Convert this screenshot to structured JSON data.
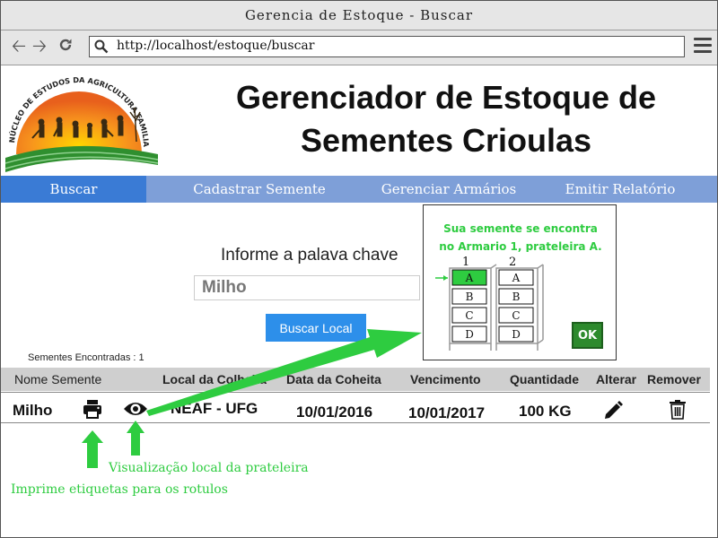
{
  "window": {
    "title": "Gerencia de Estoque - Buscar"
  },
  "browser": {
    "url": "http://localhost/estoque/buscar"
  },
  "logo": {
    "text": "NÚCLEO DE ESTUDOS DA AGRICULTURA FAMILIAR"
  },
  "header": {
    "title_line1": "Gerenciador de Estoque de",
    "title_line2": "Sementes Crioulas"
  },
  "nav": {
    "items": [
      "Buscar",
      "Cadastrar Semente",
      "Gerenciar Armários",
      "Emitir Relatório"
    ]
  },
  "search": {
    "label": "Informe a palava chave",
    "value": "Milho",
    "placeholder": "Milho",
    "button": "Buscar Local"
  },
  "results": {
    "found_label": "Sementes Encontradas : 1",
    "columns": [
      "Nome Semente",
      "Local da Colheita",
      "Data da Coheita",
      "Vencimento",
      "Quantidade",
      "Alterar",
      "Remover"
    ],
    "row": {
      "name": "Milho",
      "local": "NEAF - UFG",
      "data_colheita": "10/01/2016",
      "vencimento": "10/01/2017",
      "quantidade": "100 KG"
    }
  },
  "popup": {
    "message_line1": "Sua semente se encontra",
    "message_line2": "no Armario 1, prateleira A.",
    "cabinets": [
      {
        "label": "1",
        "shelves": [
          "A",
          "B",
          "C",
          "D"
        ],
        "highlighted": "A"
      },
      {
        "label": "2",
        "shelves": [
          "A",
          "B",
          "C",
          "D"
        ]
      }
    ],
    "ok": "OK"
  },
  "annotations": {
    "view": "Visualização local da prateleira",
    "print": "Imprime etiquetas para os rotulos"
  },
  "colors": {
    "nav_bg": "#7e9fd8",
    "nav_active": "#3a7bd5",
    "button_blue": "#2d8fea",
    "annotation_green": "#2ecc40",
    "ok_green": "#2d8a2d"
  }
}
